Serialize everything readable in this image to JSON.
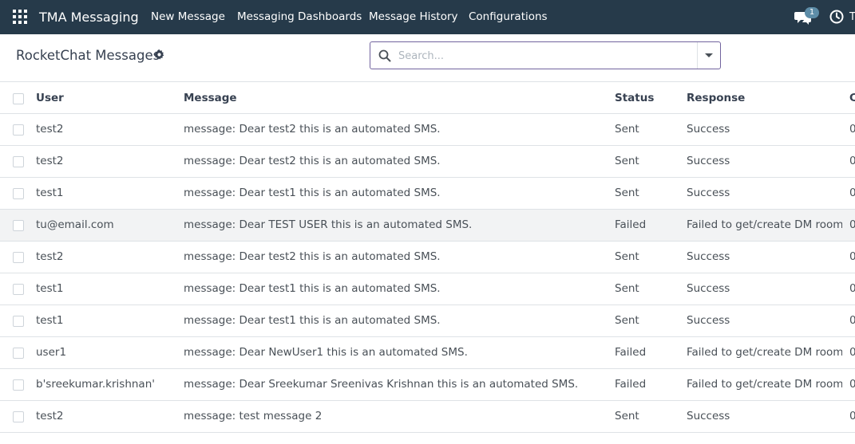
{
  "navbar": {
    "app_name": "TMA Messaging",
    "menu": [
      {
        "label": "New Message"
      },
      {
        "label": "Messaging Dashboards"
      },
      {
        "label": "Message History"
      },
      {
        "label": "Configurations"
      }
    ],
    "chat_badge": "1",
    "cut_label": "T"
  },
  "control_panel": {
    "title": "RocketChat Messages",
    "search_placeholder": "Search..."
  },
  "table": {
    "columns": [
      "User",
      "Message",
      "Status",
      "Response",
      "C"
    ],
    "rows": [
      {
        "user": "test2",
        "message": "message: Dear test2 this is an automated SMS.",
        "status": "Sent",
        "response": "Success",
        "extra": "0"
      },
      {
        "user": "test2",
        "message": "message: Dear test2 this is an automated SMS.",
        "status": "Sent",
        "response": "Success",
        "extra": "0"
      },
      {
        "user": "test1",
        "message": "message: Dear test1 this is an automated SMS.",
        "status": "Sent",
        "response": "Success",
        "extra": "0"
      },
      {
        "user": "tu@email.com",
        "message": "message: Dear TEST USER this is an automated SMS.",
        "status": "Failed",
        "response": "Failed to get/create DM room",
        "extra": "0"
      },
      {
        "user": "test2",
        "message": "message: Dear test2 this is an automated SMS.",
        "status": "Sent",
        "response": "Success",
        "extra": "0"
      },
      {
        "user": "test1",
        "message": "message: Dear test1 this is an automated SMS.",
        "status": "Sent",
        "response": "Success",
        "extra": "0"
      },
      {
        "user": "test1",
        "message": "message: Dear test1 this is an automated SMS.",
        "status": "Sent",
        "response": "Success",
        "extra": "0"
      },
      {
        "user": "user1",
        "message": "message: Dear NewUser1 this is an automated SMS.",
        "status": "Failed",
        "response": "Failed to get/create DM room",
        "extra": "0"
      },
      {
        "user": "b'sreekumar.krishnan'",
        "message": "message: Dear Sreekumar Sreenivas Krishnan this is an automated SMS.",
        "status": "Failed",
        "response": "Failed to get/create DM room",
        "extra": "0"
      },
      {
        "user": "test2",
        "message": "message: test message 2",
        "status": "Sent",
        "response": "Success",
        "extra": "0"
      }
    ]
  },
  "colors": {
    "navbar": "#263a4a",
    "accent": "#71639e",
    "badge": "#5d8da8",
    "selected_row": "#f2f3f4"
  },
  "icons": [
    "apps-grid-icon",
    "chat-icon",
    "clock-icon",
    "gear-icon",
    "search-icon",
    "caret-down-icon"
  ]
}
